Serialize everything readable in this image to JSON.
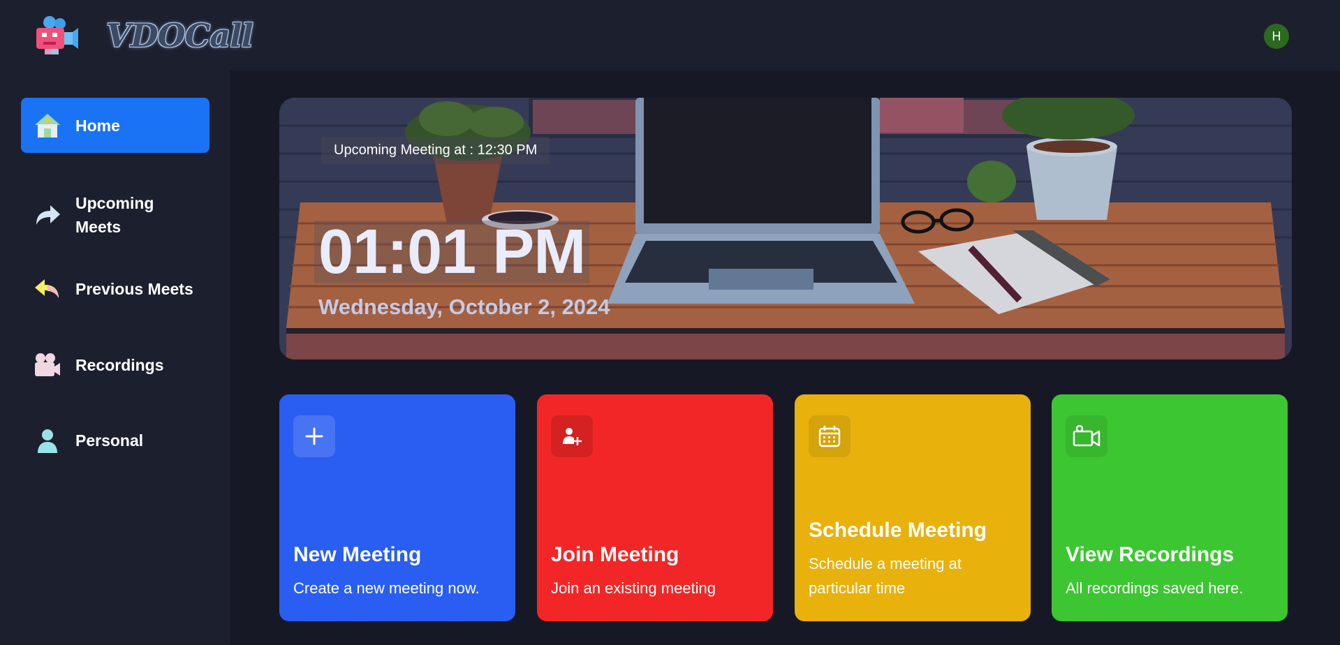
{
  "app": {
    "name": "VDOCall",
    "avatar_initial": "H"
  },
  "sidebar": {
    "items": [
      {
        "label": "Home",
        "icon": "home-icon",
        "active": true
      },
      {
        "label": "Upcoming Meets",
        "icon": "share-arrow-icon",
        "active": false
      },
      {
        "label": "Previous Meets",
        "icon": "reply-arrow-icon",
        "active": false
      },
      {
        "label": "Recordings",
        "icon": "video-camera-icon",
        "active": false
      },
      {
        "label": "Personal",
        "icon": "user-icon",
        "active": false
      }
    ]
  },
  "hero": {
    "upcoming": "Upcoming Meeting at : 12:30 PM",
    "time": "01:01 PM",
    "date": "Wednesday, October 2, 2024"
  },
  "cards": [
    {
      "title": "New Meeting",
      "description": "Create a new meeting now.",
      "color": "#2a5ef2",
      "icon": "plus-icon"
    },
    {
      "title": "Join Meeting",
      "description": "Join an existing meeting",
      "color": "#f22626",
      "icon": "user-add-icon"
    },
    {
      "title": "Schedule Meeting",
      "description": "Schedule a meeting at particular time",
      "color": "#e8b10c",
      "icon": "calendar-icon"
    },
    {
      "title": "View Recordings",
      "description": "All recordings saved here.",
      "color": "#3cc632",
      "icon": "video-icon"
    }
  ]
}
